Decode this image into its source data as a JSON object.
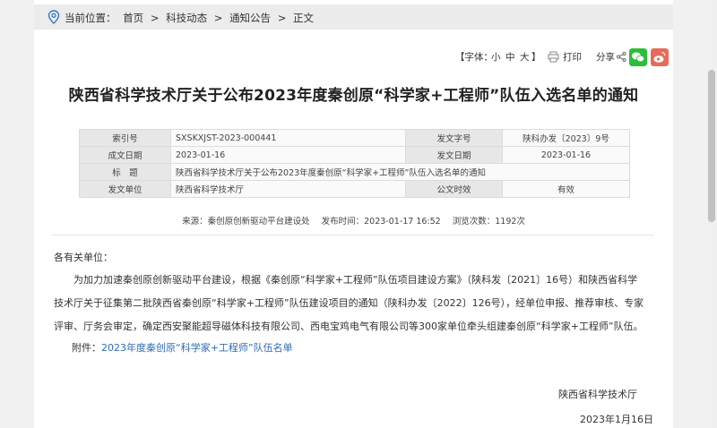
{
  "breadcrumb": {
    "prefix": "当前位置：",
    "items": [
      "首页",
      "科技动态",
      "通知公告",
      "正文"
    ],
    "separator": ">"
  },
  "toolbar": {
    "font_label": "【字体：",
    "font_small": "小",
    "font_medium": "中",
    "font_large": "大",
    "font_close": "】",
    "print_label": "打印",
    "share_label": "分享"
  },
  "article": {
    "title": "陕西省科学技术厅关于公布2023年度秦创原“科学家+工程师”队伍入选名单的通知"
  },
  "meta_table": {
    "index_label": "索引号",
    "index_value": "SXSKXJST-2023-000441",
    "doc_no_label": "发文字号",
    "doc_no_value": "陕科办发〔2023〕9号",
    "created_label": "成文日期",
    "created_value": "2023-01-16",
    "issued_label": "发文日期",
    "issued_value": "2023-01-16",
    "subject_label": "标　题",
    "subject_value": "陕西省科学技术厅关于公布2023年度秦创原“科学家+工程师”队伍入选名单的通知",
    "issuer_label": "发文单位",
    "issuer_value": "陕西省科学技术厅",
    "validity_label": "公文时效",
    "validity_value": "有效"
  },
  "source_line": {
    "source": "来源：秦创原创新驱动平台建设处",
    "published": "发布时间：2023-01-17 16:52",
    "views": "浏览次数：1192次"
  },
  "body": {
    "greeting": "各有关单位：",
    "lines": [
      "　　为加力加速秦创原创新驱动平台建设，根据《秦创原“科学家+工程师”队伍项目建设方案》（陕科发〔2021〕16号）和陕西省科学",
      "技术厅关于征集第二批陕西省秦创原“科学家+工程师”队伍建设项目的通知（陕科办发〔2022〕126号），经单位申报、推荐审核、专家",
      "评审、厅务会审定，确定西安聚能超导磁体科技有限公司、西电宝鸡电气有限公司等300家单位牵头组建秦创原“科学家+工程师”队伍。"
    ],
    "attachment_label": "附件：",
    "attachment_link": "2023年度秦创原“科学家+工程师”队伍名单",
    "signature_org": "陕西省科学技术厅",
    "signature_date": "2023年1月16日"
  },
  "colors": {
    "link": "#2e6db7",
    "wechat": "#2dbd3a",
    "weibo": "#e86a5a",
    "location_icon": "#3a78c2"
  }
}
